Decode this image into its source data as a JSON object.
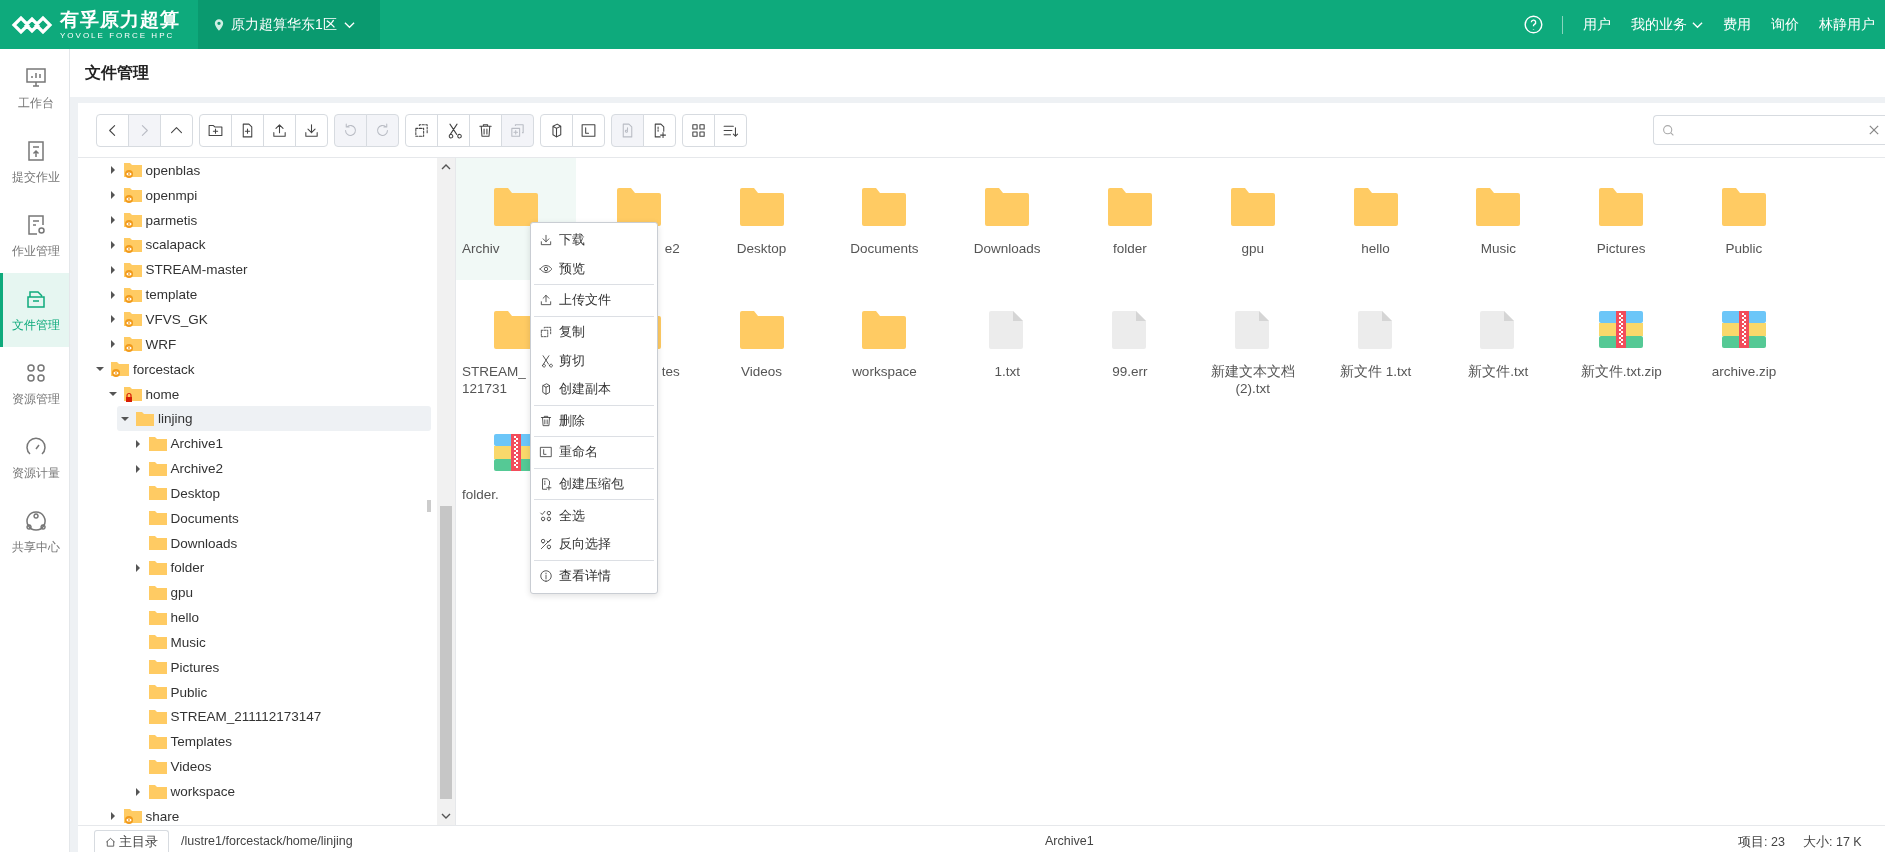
{
  "header": {
    "brand": "有孚原力超算",
    "brand_sub": "YOVOLE FORCE HPC",
    "region": "原力超算华东1区",
    "nav": [
      {
        "label": "用户",
        "dropdown": false
      },
      {
        "label": "我的业务",
        "dropdown": true
      },
      {
        "label": "费用",
        "dropdown": false
      },
      {
        "label": "询价",
        "dropdown": false
      },
      {
        "label": "林静用户",
        "dropdown": false
      }
    ]
  },
  "sidebar": {
    "items": [
      {
        "label": "工作台",
        "kind": "dashboard",
        "selected": false
      },
      {
        "label": "提交作业",
        "kind": "submit",
        "selected": false
      },
      {
        "label": "作业管理",
        "kind": "jobs",
        "selected": false
      },
      {
        "label": "文件管理",
        "kind": "files",
        "selected": true
      },
      {
        "label": "资源管理",
        "kind": "resources",
        "selected": false
      },
      {
        "label": "资源计量",
        "kind": "meter",
        "selected": false
      },
      {
        "label": "共享中心",
        "kind": "share",
        "selected": false
      }
    ]
  },
  "page_title": "文件管理",
  "toolbar": {
    "groups": [
      [
        {
          "kind": "back",
          "disabled": false
        },
        {
          "kind": "forward",
          "disabled": true
        },
        {
          "kind": "up",
          "disabled": false
        }
      ],
      [
        {
          "kind": "new_folder",
          "disabled": false
        },
        {
          "kind": "new_file",
          "disabled": false
        },
        {
          "kind": "upload",
          "disabled": false
        },
        {
          "kind": "download",
          "disabled": false
        }
      ],
      [
        {
          "kind": "undo",
          "disabled": true
        },
        {
          "kind": "redo",
          "disabled": true
        }
      ],
      [
        {
          "kind": "copy",
          "disabled": false
        },
        {
          "kind": "cut",
          "disabled": false
        },
        {
          "kind": "delete",
          "disabled": false
        },
        {
          "kind": "paste",
          "disabled": true
        }
      ],
      [
        {
          "kind": "duplicate",
          "disabled": false
        },
        {
          "kind": "rename",
          "disabled": false
        }
      ],
      [
        {
          "kind": "extract",
          "disabled": true
        },
        {
          "kind": "archive",
          "disabled": false
        }
      ],
      [
        {
          "kind": "grid",
          "disabled": false
        },
        {
          "kind": "sort",
          "disabled": false
        }
      ]
    ]
  },
  "tree": {
    "scrolled_parent_children": [
      {
        "label": "openblas",
        "shared": true,
        "expanded": false,
        "selected": false
      },
      {
        "label": "openmpi",
        "shared": true,
        "expanded": false,
        "selected": false
      },
      {
        "label": "parmetis",
        "shared": true,
        "expanded": false,
        "selected": false
      },
      {
        "label": "scalapack",
        "shared": true,
        "expanded": false,
        "selected": false
      },
      {
        "label": "STREAM-master",
        "shared": true,
        "expanded": false,
        "selected": false
      },
      {
        "label": "template",
        "shared": true,
        "expanded": false,
        "selected": false
      },
      {
        "label": "VFVS_GK",
        "shared": true,
        "expanded": false,
        "selected": false
      },
      {
        "label": "WRF",
        "shared": true,
        "expanded": false,
        "selected": false
      }
    ],
    "nodes": [
      {
        "label": "forcestack",
        "shared": true,
        "expanded": true,
        "selected": false,
        "children": [
          {
            "label": "home",
            "locked": true,
            "expanded": true,
            "selected": false,
            "children": [
              {
                "label": "linjing",
                "expanded": true,
                "selected": true,
                "children": [
                  {
                    "label": "Archive1",
                    "expanded": false,
                    "selected": false
                  },
                  {
                    "label": "Archive2",
                    "expanded": false,
                    "selected": false
                  },
                  {
                    "label": "Desktop",
                    "selected": false
                  },
                  {
                    "label": "Documents",
                    "selected": false
                  },
                  {
                    "label": "Downloads",
                    "selected": false
                  },
                  {
                    "label": "folder",
                    "expanded": false,
                    "selected": false
                  },
                  {
                    "label": "gpu",
                    "selected": false
                  },
                  {
                    "label": "hello",
                    "selected": false
                  },
                  {
                    "label": "Music",
                    "selected": false
                  },
                  {
                    "label": "Pictures",
                    "selected": false
                  },
                  {
                    "label": "Public",
                    "selected": false
                  },
                  {
                    "label": "STREAM_211112173147",
                    "selected": false
                  },
                  {
                    "label": "Templates",
                    "selected": false
                  },
                  {
                    "label": "Videos",
                    "selected": false
                  },
                  {
                    "label": "workspace",
                    "expanded": false,
                    "selected": false
                  }
                ]
              }
            ]
          },
          {
            "label": "share",
            "shared": true,
            "expanded": false,
            "selected": false
          }
        ]
      }
    ]
  },
  "files": [
    {
      "label": "Archiv",
      "kind": "folder",
      "selected": true,
      "covered_end": true
    },
    {
      "label": "e2",
      "kind": "folder",
      "selected": false,
      "covered_start": true
    },
    {
      "label": "Desktop",
      "kind": "folder",
      "selected": false
    },
    {
      "label": "Documents",
      "kind": "folder",
      "selected": false
    },
    {
      "label": "Downloads",
      "kind": "folder",
      "selected": false
    },
    {
      "label": "folder",
      "kind": "folder",
      "selected": false
    },
    {
      "label": "gpu",
      "kind": "folder",
      "selected": false
    },
    {
      "label": "hello",
      "kind": "folder",
      "selected": false
    },
    {
      "label": "Music",
      "kind": "folder",
      "selected": false
    },
    {
      "label": "Pictures",
      "kind": "folder",
      "selected": false
    },
    {
      "label": "Public",
      "kind": "folder",
      "selected": false
    },
    {
      "label": "STREAM_\n121731",
      "kind": "folder",
      "selected": false,
      "covered_end": true
    },
    {
      "label": "tes",
      "kind": "folder",
      "selected": false,
      "covered_start": true
    },
    {
      "label": "Videos",
      "kind": "folder",
      "selected": false
    },
    {
      "label": "workspace",
      "kind": "folder",
      "selected": false
    },
    {
      "label": "1.txt",
      "kind": "file",
      "selected": false
    },
    {
      "label": "99.err",
      "kind": "file",
      "selected": false
    },
    {
      "label": "新建文本文档(2).txt",
      "kind": "file",
      "selected": false
    },
    {
      "label": "新文件 1.txt",
      "kind": "file",
      "selected": false
    },
    {
      "label": "新文件.txt",
      "kind": "file",
      "selected": false
    },
    {
      "label": "新文件.txt.zip",
      "kind": "zip",
      "selected": false
    },
    {
      "label": "archive.zip",
      "kind": "zip",
      "selected": false
    },
    {
      "label": "folder.",
      "kind": "zip",
      "selected": false,
      "covered_end": true
    }
  ],
  "context_menu": {
    "groups": [
      [
        {
          "label": "下载",
          "kind": "download"
        },
        {
          "label": "预览",
          "kind": "preview"
        }
      ],
      [
        {
          "label": "上传文件",
          "kind": "upload"
        }
      ],
      [
        {
          "label": "复制",
          "kind": "copy"
        },
        {
          "label": "剪切",
          "kind": "cut"
        },
        {
          "label": "创建副本",
          "kind": "duplicate"
        }
      ],
      [
        {
          "label": "删除",
          "kind": "delete"
        }
      ],
      [
        {
          "label": "重命名",
          "kind": "rename"
        }
      ],
      [
        {
          "label": "创建压缩包",
          "kind": "archive"
        }
      ],
      [
        {
          "label": "全选",
          "kind": "select_all"
        },
        {
          "label": "反向选择",
          "kind": "invert"
        }
      ],
      [
        {
          "label": "查看详情",
          "kind": "info"
        }
      ]
    ]
  },
  "status_bar": {
    "home_button": "主目录",
    "path": "/lustre1/forcestack/home/linjing",
    "selected_name": "Archive1",
    "items": "项目: 23",
    "size": "大小: 17 K"
  }
}
